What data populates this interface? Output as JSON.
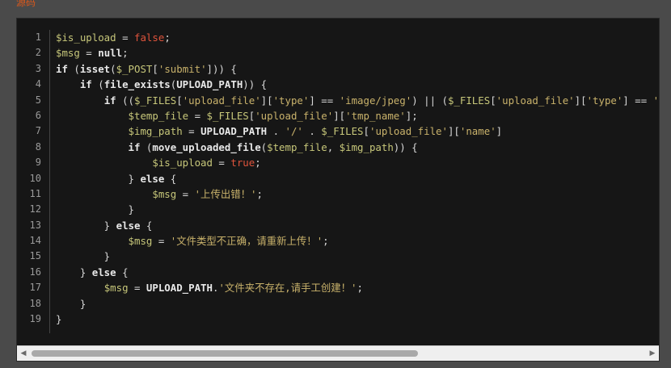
{
  "top_fragment": "源码",
  "code": {
    "language": "php",
    "line_numbers": [
      "1",
      "2",
      "3",
      "4",
      "5",
      "6",
      "7",
      "8",
      "9",
      "10",
      "11",
      "12",
      "13",
      "14",
      "15",
      "16",
      "17",
      "18",
      "19"
    ],
    "lines": [
      [
        {
          "t": "var",
          "v": "$is_upload"
        },
        {
          "t": "plain",
          "v": " = "
        },
        {
          "t": "lit",
          "v": "false"
        },
        {
          "t": "plain",
          "v": ";"
        }
      ],
      [
        {
          "t": "var",
          "v": "$msg"
        },
        {
          "t": "plain",
          "v": " = "
        },
        {
          "t": "kw",
          "v": "null"
        },
        {
          "t": "plain",
          "v": ";"
        }
      ],
      [
        {
          "t": "kw",
          "v": "if"
        },
        {
          "t": "plain",
          "v": " ("
        },
        {
          "t": "fn",
          "v": "isset"
        },
        {
          "t": "plain",
          "v": "("
        },
        {
          "t": "var",
          "v": "$_POST"
        },
        {
          "t": "plain",
          "v": "["
        },
        {
          "t": "str",
          "v": "'submit'"
        },
        {
          "t": "plain",
          "v": "])) {"
        }
      ],
      [
        {
          "t": "plain",
          "v": "    "
        },
        {
          "t": "kw",
          "v": "if"
        },
        {
          "t": "plain",
          "v": " ("
        },
        {
          "t": "fn",
          "v": "file_exists"
        },
        {
          "t": "plain",
          "v": "("
        },
        {
          "t": "const",
          "v": "UPLOAD_PATH"
        },
        {
          "t": "plain",
          "v": ")) {"
        }
      ],
      [
        {
          "t": "plain",
          "v": "        "
        },
        {
          "t": "kw",
          "v": "if"
        },
        {
          "t": "plain",
          "v": " (("
        },
        {
          "t": "var",
          "v": "$_FILES"
        },
        {
          "t": "plain",
          "v": "["
        },
        {
          "t": "str",
          "v": "'upload_file'"
        },
        {
          "t": "plain",
          "v": "]["
        },
        {
          "t": "str",
          "v": "'type'"
        },
        {
          "t": "plain",
          "v": "] == "
        },
        {
          "t": "str",
          "v": "'image/jpeg'"
        },
        {
          "t": "plain",
          "v": ") || ("
        },
        {
          "t": "var",
          "v": "$_FILES"
        },
        {
          "t": "plain",
          "v": "["
        },
        {
          "t": "str",
          "v": "'upload_file'"
        },
        {
          "t": "plain",
          "v": "]["
        },
        {
          "t": "str",
          "v": "'type'"
        },
        {
          "t": "plain",
          "v": "] == "
        },
        {
          "t": "str",
          "v": "'image"
        }
      ],
      [
        {
          "t": "plain",
          "v": "            "
        },
        {
          "t": "var",
          "v": "$temp_file"
        },
        {
          "t": "plain",
          "v": " = "
        },
        {
          "t": "var",
          "v": "$_FILES"
        },
        {
          "t": "plain",
          "v": "["
        },
        {
          "t": "str",
          "v": "'upload_file'"
        },
        {
          "t": "plain",
          "v": "]["
        },
        {
          "t": "str",
          "v": "'tmp_name'"
        },
        {
          "t": "plain",
          "v": "];"
        }
      ],
      [
        {
          "t": "plain",
          "v": "            "
        },
        {
          "t": "var",
          "v": "$img_path"
        },
        {
          "t": "plain",
          "v": " = "
        },
        {
          "t": "const",
          "v": "UPLOAD_PATH"
        },
        {
          "t": "plain",
          "v": " . "
        },
        {
          "t": "str",
          "v": "'/'"
        },
        {
          "t": "plain",
          "v": " . "
        },
        {
          "t": "var",
          "v": "$_FILES"
        },
        {
          "t": "plain",
          "v": "["
        },
        {
          "t": "str",
          "v": "'upload_file'"
        },
        {
          "t": "plain",
          "v": "]["
        },
        {
          "t": "str",
          "v": "'name'"
        },
        {
          "t": "plain",
          "v": "]"
        }
      ],
      [
        {
          "t": "plain",
          "v": "            "
        },
        {
          "t": "kw",
          "v": "if"
        },
        {
          "t": "plain",
          "v": " ("
        },
        {
          "t": "fn",
          "v": "move_uploaded_file"
        },
        {
          "t": "plain",
          "v": "("
        },
        {
          "t": "var",
          "v": "$temp_file"
        },
        {
          "t": "plain",
          "v": ", "
        },
        {
          "t": "var",
          "v": "$img_path"
        },
        {
          "t": "plain",
          "v": ")) {"
        }
      ],
      [
        {
          "t": "plain",
          "v": "                "
        },
        {
          "t": "var",
          "v": "$is_upload"
        },
        {
          "t": "plain",
          "v": " = "
        },
        {
          "t": "lit",
          "v": "true"
        },
        {
          "t": "plain",
          "v": ";"
        }
      ],
      [
        {
          "t": "plain",
          "v": "            } "
        },
        {
          "t": "kw",
          "v": "else"
        },
        {
          "t": "plain",
          "v": " {"
        }
      ],
      [
        {
          "t": "plain",
          "v": "                "
        },
        {
          "t": "var",
          "v": "$msg"
        },
        {
          "t": "plain",
          "v": " = "
        },
        {
          "t": "str",
          "v": "'上传出错！'"
        },
        {
          "t": "plain",
          "v": ";"
        }
      ],
      [
        {
          "t": "plain",
          "v": "            }"
        }
      ],
      [
        {
          "t": "plain",
          "v": "        } "
        },
        {
          "t": "kw",
          "v": "else"
        },
        {
          "t": "plain",
          "v": " {"
        }
      ],
      [
        {
          "t": "plain",
          "v": "            "
        },
        {
          "t": "var",
          "v": "$msg"
        },
        {
          "t": "plain",
          "v": " = "
        },
        {
          "t": "str",
          "v": "'文件类型不正确，请重新上传！'"
        },
        {
          "t": "plain",
          "v": ";"
        }
      ],
      [
        {
          "t": "plain",
          "v": "        }"
        }
      ],
      [
        {
          "t": "plain",
          "v": "    } "
        },
        {
          "t": "kw",
          "v": "else"
        },
        {
          "t": "plain",
          "v": " {"
        }
      ],
      [
        {
          "t": "plain",
          "v": "        "
        },
        {
          "t": "var",
          "v": "$msg"
        },
        {
          "t": "plain",
          "v": " = "
        },
        {
          "t": "const",
          "v": "UPLOAD_PATH"
        },
        {
          "t": "plain",
          "v": "."
        },
        {
          "t": "str",
          "v": "'文件夹不存在,请手工创建！'"
        },
        {
          "t": "plain",
          "v": ";"
        }
      ],
      [
        {
          "t": "plain",
          "v": "    }"
        }
      ],
      [
        {
          "t": "plain",
          "v": "}"
        }
      ]
    ]
  },
  "scrollbar": {
    "left_arrow": "◀",
    "right_arrow": "▶",
    "thumb_fraction": 0.63,
    "position_fraction": 0.0
  },
  "colors": {
    "background": "#4a4a4a",
    "code_background": "#161616",
    "variable": "#c7c77a",
    "string": "#c9b26b",
    "literal": "#e0543c",
    "keyword": "#e8e8e8"
  }
}
